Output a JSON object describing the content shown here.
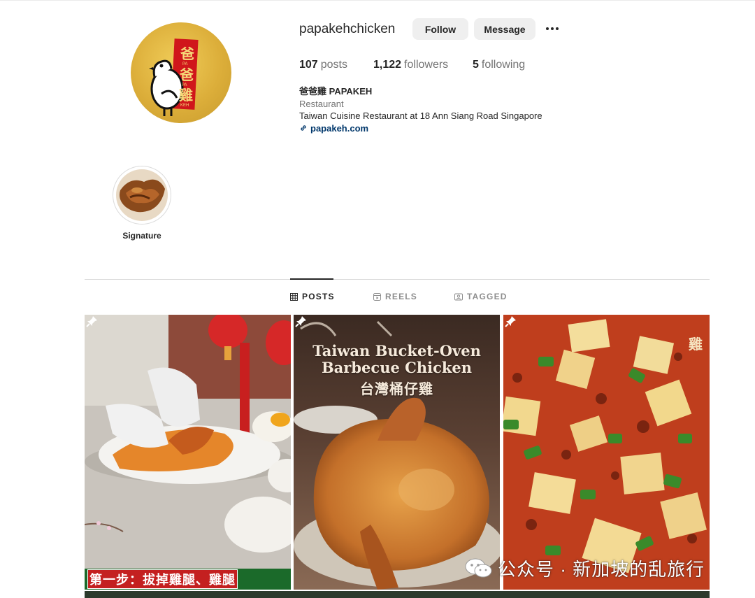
{
  "profile": {
    "username": "papakehchicken",
    "follow_label": "Follow",
    "message_label": "Message",
    "more_icon": "more-options-icon",
    "stats": {
      "posts_count": "107",
      "posts_label": "posts",
      "followers_count": "1,122",
      "followers_label": "followers",
      "following_count": "5",
      "following_label": "following"
    },
    "bio": {
      "name": "爸爸雞 PAPAKEH",
      "category": "Restaurant",
      "description": "Taiwan Cuisine Restaurant at 18 Ann Siang Road Singapore",
      "link": "papakeh.com"
    },
    "logo_text": [
      "爸",
      "PA",
      "爸",
      "PA",
      "雞",
      "KEH"
    ]
  },
  "highlights": [
    {
      "label": "Signature"
    }
  ],
  "tabs": [
    {
      "label": "POSTS",
      "icon": "grid-icon",
      "active": true
    },
    {
      "label": "REELS",
      "icon": "reels-icon",
      "active": false
    },
    {
      "label": "TAGGED",
      "icon": "tagged-icon",
      "active": false
    }
  ],
  "posts": [
    {
      "pinned": true,
      "caption": "第一步：拔掉雞腿、雞腿"
    },
    {
      "pinned": true,
      "title_line1": "Taiwan Bucket-Oven",
      "title_line2": "Barbecue Chicken",
      "title_line3": "台灣桶仔雞"
    },
    {
      "pinned": true,
      "corner_text": "雞"
    }
  ],
  "watermark": "公众号 · 新加坡的乱旅行",
  "colors": {
    "button_bg": "#efefef",
    "link": "#00376b",
    "muted": "#737373",
    "divider": "#dbdbdb",
    "logo_gold": "#dcae3a",
    "logo_red": "#d0161b"
  }
}
